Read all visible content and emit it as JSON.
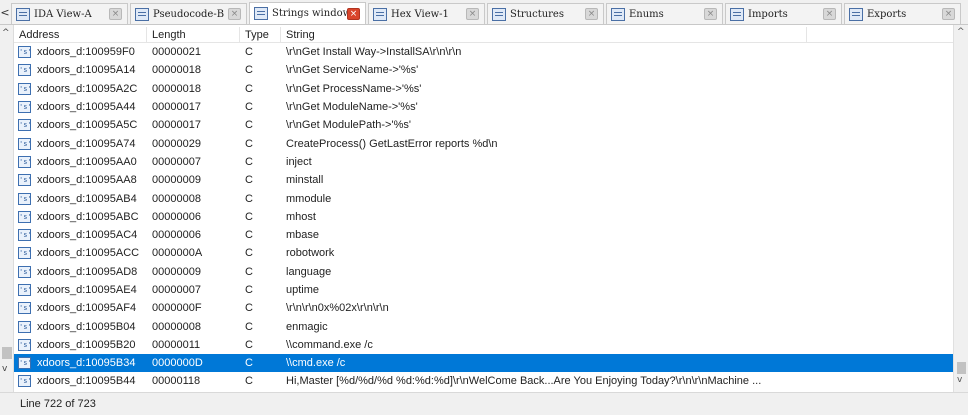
{
  "tabs": [
    {
      "label": "IDA View-A",
      "icon": "ida-view-icon",
      "active": false
    },
    {
      "label": "Pseudocode-B",
      "icon": "pseudocode-icon",
      "active": false
    },
    {
      "label": "Strings window",
      "icon": "strings-icon",
      "active": true
    },
    {
      "label": "Hex View-1",
      "icon": "hex-view-icon",
      "active": false
    },
    {
      "label": "Structures",
      "icon": "structures-icon",
      "active": false
    },
    {
      "label": "Enums",
      "icon": "enums-icon",
      "active": false
    },
    {
      "label": "Imports",
      "icon": "imports-icon",
      "active": false
    },
    {
      "label": "Exports",
      "icon": "exports-icon",
      "active": false
    }
  ],
  "tab_close_glyph": "×",
  "columns": {
    "address": "Address",
    "length": "Length",
    "type": "Type",
    "string": "String"
  },
  "string_icon_glyph": "'s'",
  "rows": [
    {
      "address": "xdoors_d:100959F0",
      "length": "00000021",
      "type": "C",
      "string": "\\r\\nGet Install Way->InstallSA\\r\\n\\r\\n"
    },
    {
      "address": "xdoors_d:10095A14",
      "length": "00000018",
      "type": "C",
      "string": "\\r\\nGet ServiceName->'%s'"
    },
    {
      "address": "xdoors_d:10095A2C",
      "length": "00000018",
      "type": "C",
      "string": "\\r\\nGet ProcessName->'%s'"
    },
    {
      "address": "xdoors_d:10095A44",
      "length": "00000017",
      "type": "C",
      "string": "\\r\\nGet ModuleName->'%s'"
    },
    {
      "address": "xdoors_d:10095A5C",
      "length": "00000017",
      "type": "C",
      "string": "\\r\\nGet ModulePath->'%s'"
    },
    {
      "address": "xdoors_d:10095A74",
      "length": "00000029",
      "type": "C",
      "string": "CreateProcess() GetLastError reports %d\\n"
    },
    {
      "address": "xdoors_d:10095AA0",
      "length": "00000007",
      "type": "C",
      "string": "inject"
    },
    {
      "address": "xdoors_d:10095AA8",
      "length": "00000009",
      "type": "C",
      "string": "minstall"
    },
    {
      "address": "xdoors_d:10095AB4",
      "length": "00000008",
      "type": "C",
      "string": "mmodule"
    },
    {
      "address": "xdoors_d:10095ABC",
      "length": "00000006",
      "type": "C",
      "string": "mhost"
    },
    {
      "address": "xdoors_d:10095AC4",
      "length": "00000006",
      "type": "C",
      "string": "mbase"
    },
    {
      "address": "xdoors_d:10095ACC",
      "length": "0000000A",
      "type": "C",
      "string": "robotwork"
    },
    {
      "address": "xdoors_d:10095AD8",
      "length": "00000009",
      "type": "C",
      "string": "language"
    },
    {
      "address": "xdoors_d:10095AE4",
      "length": "00000007",
      "type": "C",
      "string": "uptime"
    },
    {
      "address": "xdoors_d:10095AF4",
      "length": "0000000F",
      "type": "C",
      "string": "\\r\\n\\r\\n0x%02x\\r\\n\\r\\n"
    },
    {
      "address": "xdoors_d:10095B04",
      "length": "00000008",
      "type": "C",
      "string": "enmagic"
    },
    {
      "address": "xdoors_d:10095B20",
      "length": "00000011",
      "type": "C",
      "string": "\\\\command.exe /c"
    },
    {
      "address": "xdoors_d:10095B34",
      "length": "0000000D",
      "type": "C",
      "string": "\\\\cmd.exe /c",
      "selected": true
    },
    {
      "address": "xdoors_d:10095B44",
      "length": "00000118",
      "type": "C",
      "string": "Hi,Master [%d/%d/%d %d:%d:%d]\\r\\nWelCome Back...Are You Enjoying Today?\\r\\n\\r\\nMachine ..."
    }
  ],
  "status": {
    "text": "Line 722 of 723"
  },
  "scroll": {
    "left_arrow": "<",
    "up_arrow": "^",
    "down_arrow": "v"
  },
  "colors": {
    "selection": "#0078d7",
    "active_tab_close": "#d9452b"
  }
}
